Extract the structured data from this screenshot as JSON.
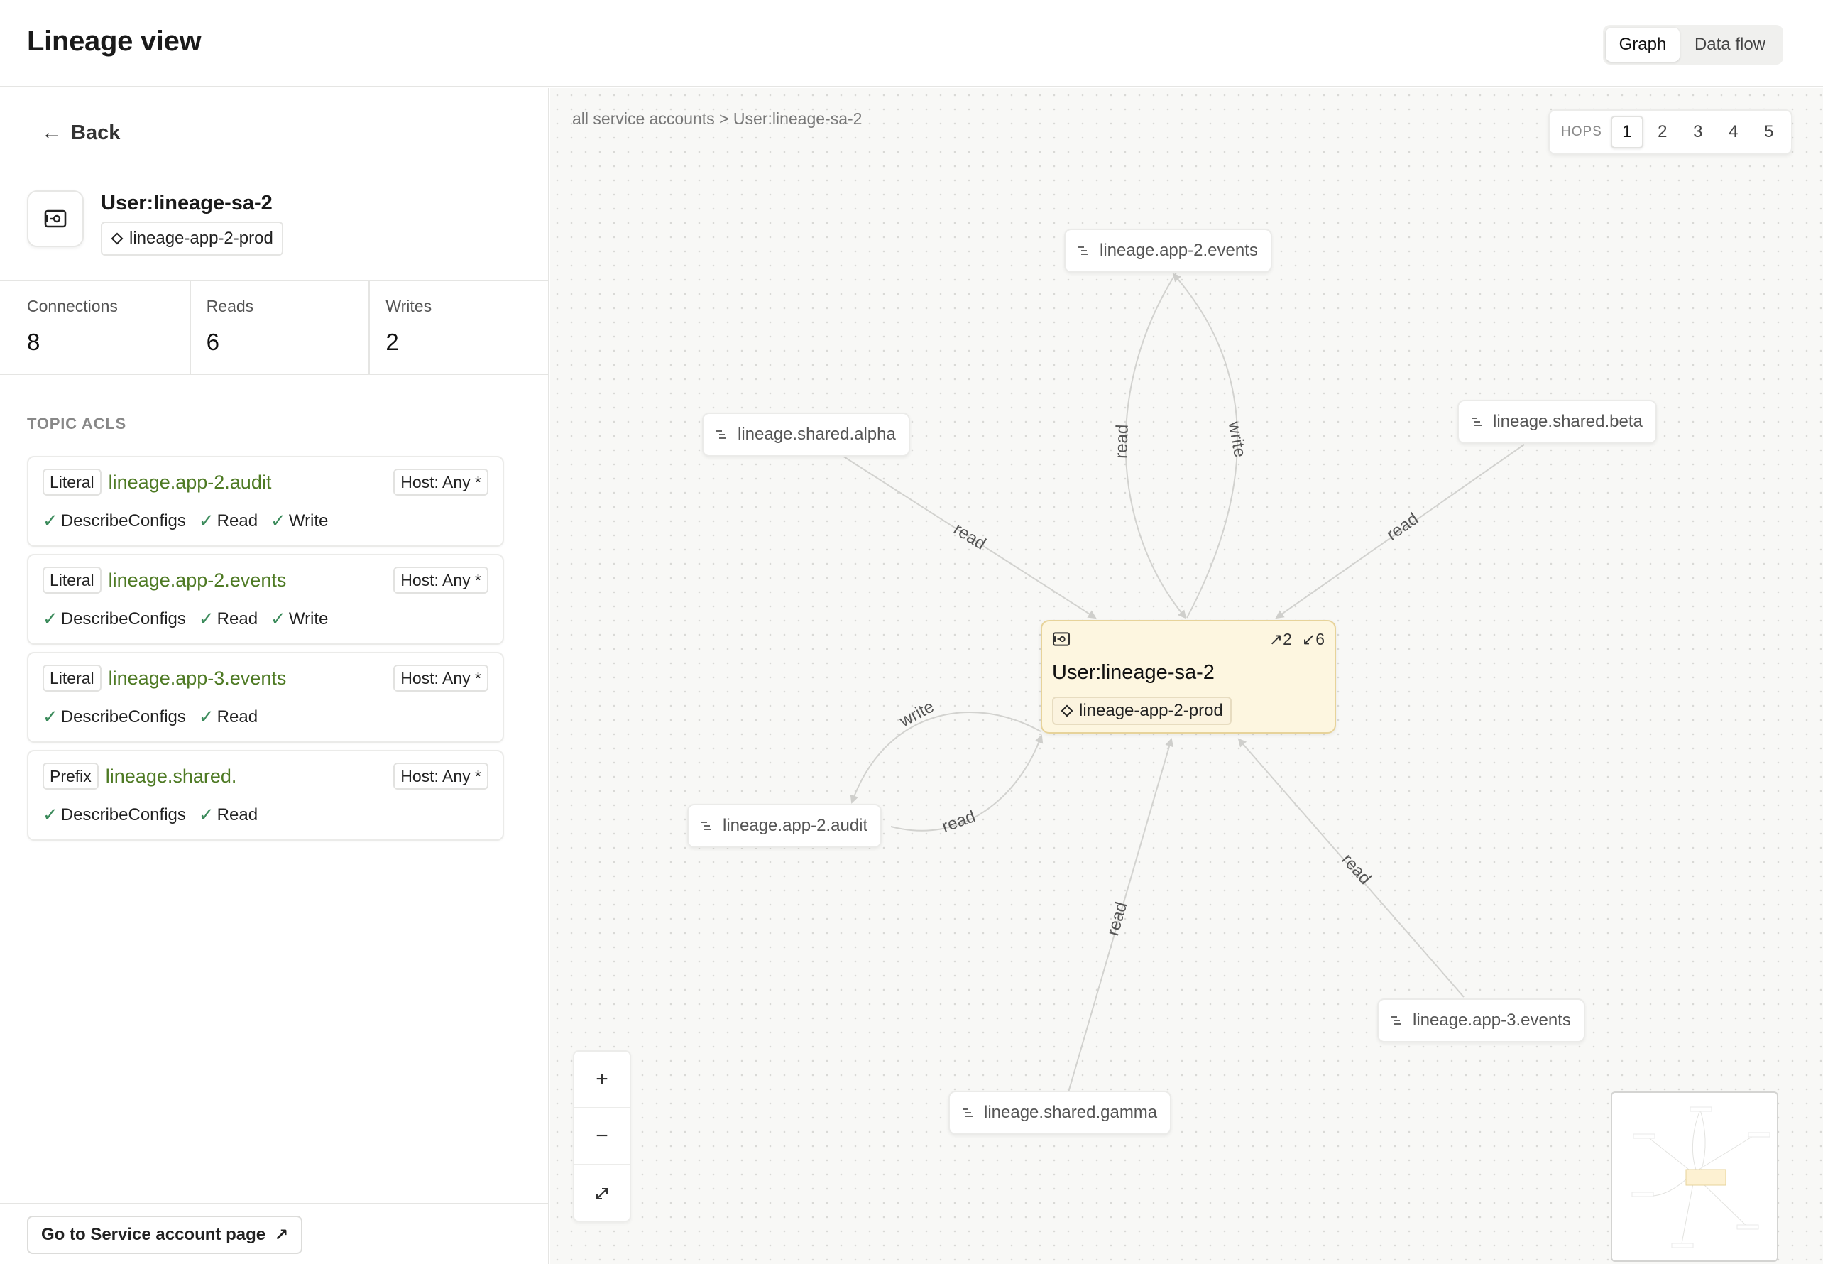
{
  "header": {
    "title": "Lineage view",
    "view_toggle": {
      "graph": "Graph",
      "data_flow": "Data flow",
      "selected": "Graph"
    }
  },
  "left": {
    "back_label": "Back",
    "account": {
      "name": "User:lineage-sa-2",
      "environment": "lineage-app-2-prod",
      "icon": "service-account-icon"
    },
    "stats": [
      {
        "label": "Connections",
        "value": "8"
      },
      {
        "label": "Reads",
        "value": "6"
      },
      {
        "label": "Writes",
        "value": "2"
      }
    ],
    "acl_section_title": "TOPIC ACLS",
    "acls": [
      {
        "pattern": "Literal",
        "topic": "lineage.app-2.audit",
        "host": "Host: Any *",
        "perms": [
          "DescribeConfigs",
          "Read",
          "Write"
        ]
      },
      {
        "pattern": "Literal",
        "topic": "lineage.app-2.events",
        "host": "Host: Any *",
        "perms": [
          "DescribeConfigs",
          "Read",
          "Write"
        ]
      },
      {
        "pattern": "Literal",
        "topic": "lineage.app-3.events",
        "host": "Host: Any *",
        "perms": [
          "DescribeConfigs",
          "Read"
        ]
      },
      {
        "pattern": "Prefix",
        "topic": "lineage.shared.",
        "host": "Host: Any *",
        "perms": [
          "DescribeConfigs",
          "Read"
        ]
      }
    ],
    "goto_label": "Go to Service account page"
  },
  "canvas": {
    "breadcrumb": "all service accounts > User:lineage-sa-2",
    "hops_label": "HOPS",
    "hops": [
      "1",
      "2",
      "3",
      "4",
      "5"
    ],
    "selected_hop": "1",
    "center": {
      "name": "User:lineage-sa-2",
      "env": "lineage-app-2-prod",
      "out_count": "2",
      "in_count": "6"
    },
    "topics": {
      "app2_events": "lineage.app-2.events",
      "shared_alpha": "lineage.shared.alpha",
      "shared_beta": "lineage.shared.beta",
      "app2_audit": "lineage.app-2.audit",
      "app3_events": "lineage.app-3.events",
      "shared_gamma": "lineage.shared.gamma"
    },
    "edge_labels": {
      "read": "read",
      "write": "write"
    },
    "zoom": {
      "in": "+",
      "out": "−",
      "fit": "fit-icon"
    },
    "colors": {
      "topic_link": "#4e7a24",
      "center_bg": "#fdf6e0",
      "center_border": "#e7d39a",
      "check": "#3a8a5a"
    }
  }
}
